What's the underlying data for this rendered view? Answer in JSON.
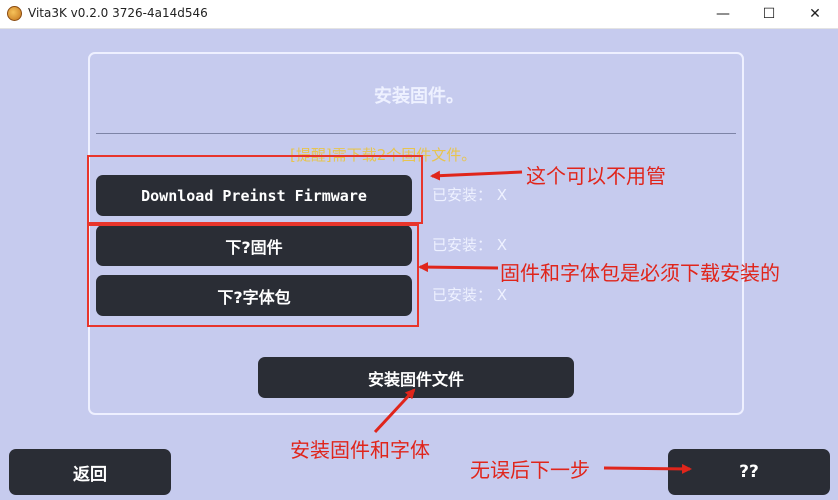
{
  "window": {
    "title": "Vita3K v0.2.0 3726-4a14d546",
    "minimize_glyph": "—",
    "maximize_glyph": "☐",
    "close_glyph": "✕"
  },
  "dialog": {
    "title": "安装固件。",
    "faded_notice": "[提醒]需下载2个固件文件。",
    "rows": [
      {
        "button_label": "Download Preinst Firmware",
        "status": "已安装： X"
      },
      {
        "button_label": "下?固件",
        "status": "已安装： X"
      },
      {
        "button_label": "下?字体包",
        "status": "已安装： X"
      }
    ],
    "install_button_label": "安装固件文件"
  },
  "footer": {
    "back_label": "返回",
    "next_label": "??"
  },
  "annotations": {
    "note_preinst": "这个可以不用管",
    "note_required": "固件和字体包是必须下载安装的",
    "note_install": "安装固件和字体",
    "note_next": "无误后下一步",
    "color": "#e0251b"
  },
  "colors": {
    "background": "#c6cbee",
    "button": "#2a2d35",
    "panel_border": "#eef0ff",
    "notice": "#f3c21a"
  },
  "icons": {
    "app": "vita3k-app-icon"
  }
}
